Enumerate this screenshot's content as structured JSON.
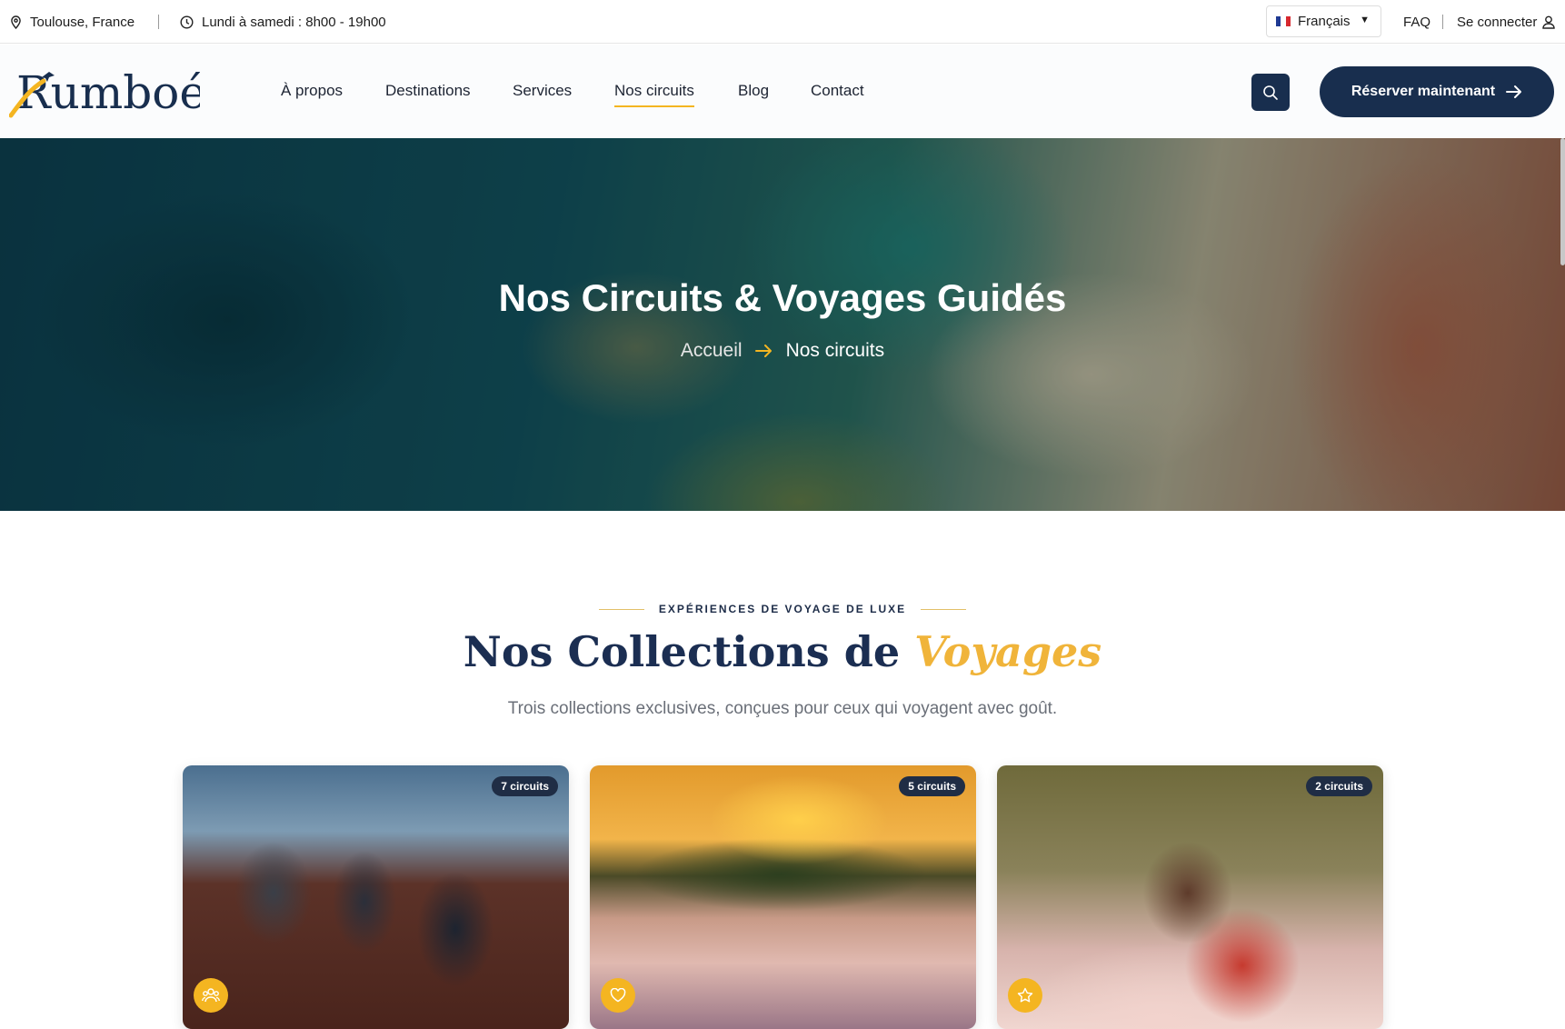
{
  "topbar": {
    "location": "Toulouse, France",
    "hours": "Lundi à samedi : 8h00 - 19h00",
    "language": "Français",
    "faq": "FAQ",
    "login": "Se connecter"
  },
  "brand": {
    "name": "Rumboé",
    "navy": "#182e4e",
    "gold": "#f4b521"
  },
  "nav": {
    "items": [
      "À propos",
      "Destinations",
      "Services",
      "Nos circuits",
      "Blog",
      "Contact"
    ],
    "active": "Nos circuits",
    "cta": "Réserver maintenant"
  },
  "hero": {
    "title": "Nos Circuits & Voyages Guidés",
    "breadcrumb_home": "Accueil",
    "breadcrumb_current": "Nos circuits"
  },
  "collections": {
    "eyebrow": "EXPÉRIENCES DE VOYAGE DE LUXE",
    "title_main": "Nos Collections de",
    "title_accent": "Voyages",
    "lead": "Trois collections exclusives, conçues pour ceux qui voyagent avec goût.",
    "cards": [
      {
        "badge": "7 circuits",
        "icon": "group-icon"
      },
      {
        "badge": "5 circuits",
        "icon": "heart-icon"
      },
      {
        "badge": "2 circuits",
        "icon": "star-icon"
      }
    ]
  }
}
